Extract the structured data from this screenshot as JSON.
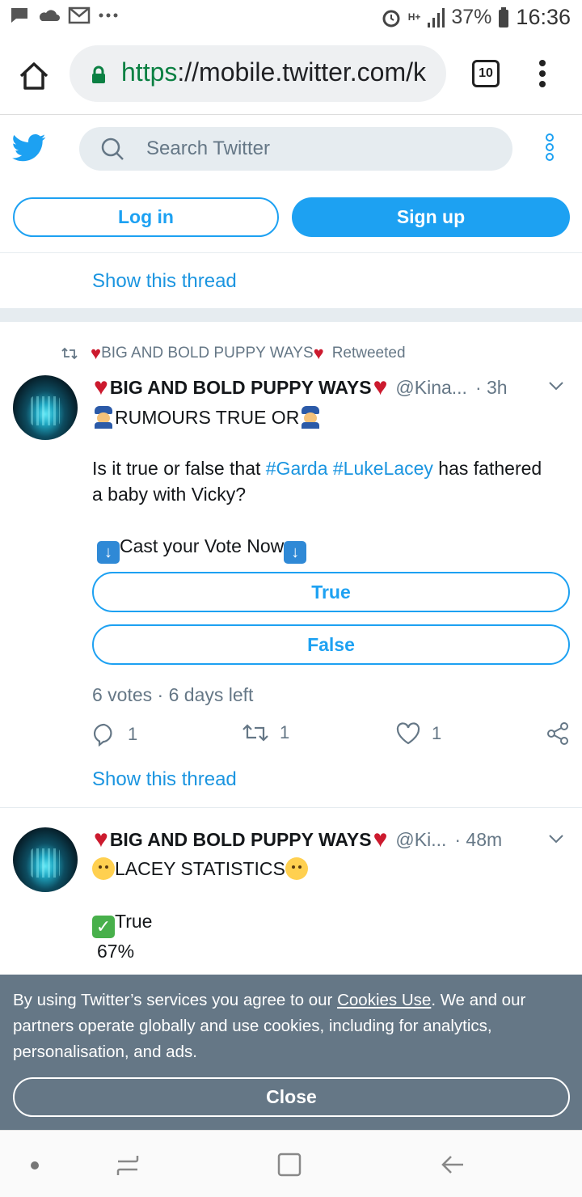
{
  "status_bar": {
    "battery_percent": "37%",
    "time": "16:36",
    "network": "H+",
    "icons": [
      "message-icon",
      "cloud-icon",
      "gmail-icon",
      "more-dots-icon",
      "alarm-icon",
      "network-icon",
      "signal-icon",
      "battery-icon"
    ]
  },
  "browser": {
    "url_scheme": "https",
    "url_rest": "://mobile.twitter.com/k",
    "tab_count": "10"
  },
  "header": {
    "search_placeholder": "Search Twitter",
    "login_label": "Log in",
    "signup_label": "Sign up"
  },
  "thread_link_1": "Show this thread",
  "tweet1": {
    "retweeted_by": "BIG AND BOLD PUPPY WAYS",
    "retweeted_label": "Retweeted",
    "author_name": "BIG AND BOLD PUPPY WAYS",
    "handle": "@Kina...",
    "time": "· 3h",
    "headline": "RUMOURS TRUE OR",
    "body_pre": "Is it true or false that ",
    "hashtag1": "#Garda",
    "hashtag2": "#LukeLacey",
    "body_post": " has fathered",
    "body_line2": "a baby with Vicky?",
    "cta": "Cast your Vote Now",
    "poll_options": [
      "True",
      "False"
    ],
    "poll_meta": "6 votes · 6 days left",
    "replies": "1",
    "retweets": "1",
    "likes": "1",
    "show_thread": "Show this thread"
  },
  "tweet2": {
    "author_name": "BIG AND BOLD PUPPY WAYS",
    "handle": "@Ki...",
    "time": "· 48m",
    "headline": "LACEY STATISTICS",
    "result_label": "True",
    "result_percent": "67%"
  },
  "cookie_banner": {
    "text_pre": "By using Twitter’s services you agree to our ",
    "link": "Cookies Use",
    "text_post": ". We and our partners operate globally and use cookies, including for analytics, personalisation, and ads.",
    "close_label": "Close"
  },
  "colors": {
    "twitter_blue": "#1da1f2",
    "link_blue": "#1b95e0",
    "cookie_bg": "#657786",
    "heart_red": "#cc1a2e"
  }
}
